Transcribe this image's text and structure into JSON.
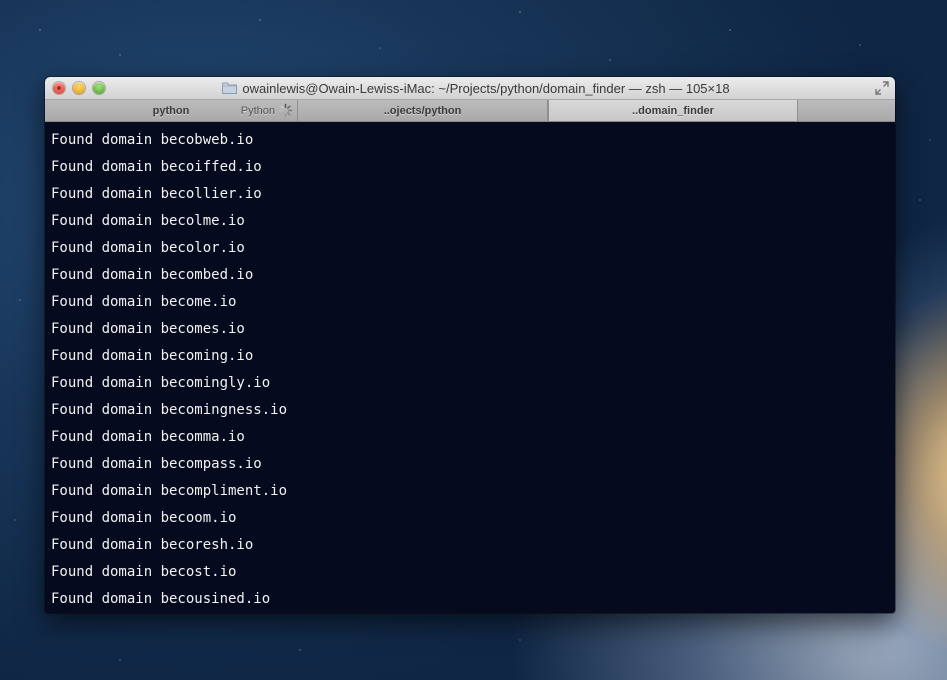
{
  "window": {
    "title": "owainlewis@Owain-Lewiss-iMac: ~/Projects/python/domain_finder — zsh — 105×18"
  },
  "tabs": [
    {
      "label": "python",
      "process": "Python",
      "icon": "spinner-icon"
    },
    {
      "label": "..ojects/python"
    },
    {
      "label": "..domain_finder"
    }
  ],
  "terminal": {
    "lines": [
      "Found domain becobweb.io",
      "Found domain becoiffed.io",
      "Found domain becollier.io",
      "Found domain becolme.io",
      "Found domain becolor.io",
      "Found domain becombed.io",
      "Found domain become.io",
      "Found domain becomes.io",
      "Found domain becoming.io",
      "Found domain becomingly.io",
      "Found domain becomingness.io",
      "Found domain becomma.io",
      "Found domain becompass.io",
      "Found domain becompliment.io",
      "Found domain becoom.io",
      "Found domain becoresh.io",
      "Found domain becost.io",
      "Found domain becousined.io"
    ]
  },
  "colors": {
    "terminal_bg": "#060a1e",
    "terminal_fg": "#f2f2f2",
    "close": "#d93a2e",
    "minimize": "#dd9c16",
    "zoom": "#4e9f26"
  }
}
